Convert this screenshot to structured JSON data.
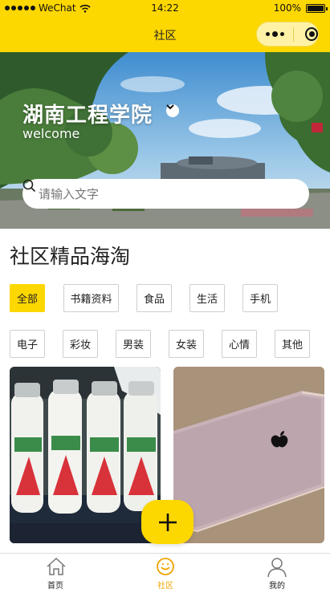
{
  "status_bar": {
    "carrier": "WeChat",
    "time": "14:22",
    "battery": "100%"
  },
  "nav": {
    "title": "社区"
  },
  "hero": {
    "campus": "湖南工程学院",
    "welcome": "welcome",
    "search_placeholder": "请输入文字"
  },
  "section": {
    "title": "社区精品海淘"
  },
  "categories": [
    {
      "label": "全部",
      "active": true
    },
    {
      "label": "书籍资料"
    },
    {
      "label": "食品"
    },
    {
      "label": "生活"
    },
    {
      "label": "手机"
    },
    {
      "label": "电子"
    },
    {
      "label": "彩妆"
    },
    {
      "label": "男装"
    },
    {
      "label": "女装"
    },
    {
      "label": "心情"
    },
    {
      "label": "其他"
    }
  ],
  "tabbar": [
    {
      "label": "首页",
      "icon": "home-icon"
    },
    {
      "label": "社区",
      "icon": "community-icon",
      "active": true
    },
    {
      "label": "我的",
      "icon": "profile-icon"
    }
  ],
  "colors": {
    "accent": "#fdd700",
    "active_tab": "#f0a400"
  }
}
